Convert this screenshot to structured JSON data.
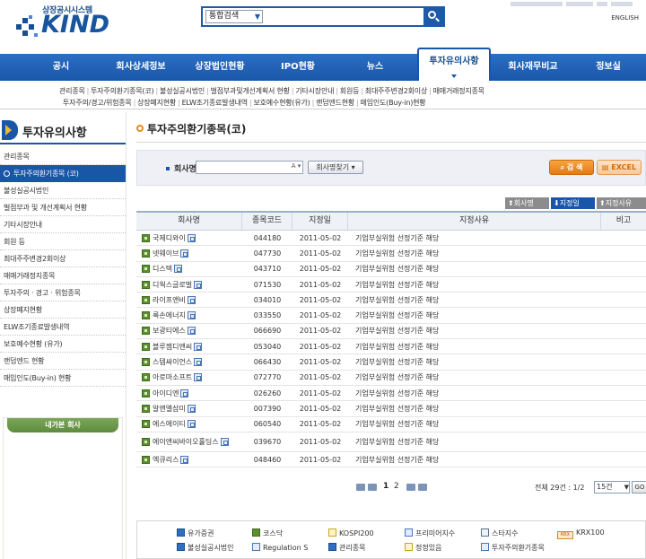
{
  "header": {
    "logo_sub": "상장공시시스템",
    "logo": "KIND",
    "search_scope": "통합검색",
    "search_value": "",
    "english": "ENGLISH"
  },
  "nav": {
    "items": [
      "공시",
      "회사상세정보",
      "상장법인현황",
      "IPO현황",
      "뉴스",
      "투자유의사항",
      "회사재무비교",
      "정보실"
    ]
  },
  "subnav": {
    "row1": [
      "관리종목",
      "투자주의환기종목(코)",
      "불성실공시법인",
      "벌점부과및개선계획서 현황",
      "기타시장안내",
      "회원등",
      "최대주주변경2회이상",
      "매매거래정지종목"
    ],
    "row2": [
      "투자주의/경고/위험종목",
      "상장폐지현황",
      "ELW조기종료발생내역",
      "보호예수현황(유가)",
      "랜덤엔드현황",
      "매입인도(Buy-in)현황"
    ]
  },
  "sidebar": {
    "title": "투자유의사항",
    "items": [
      "관리종목",
      "투자주의환기종목 (코)",
      "불성실공시법인",
      "벌점부과 및 개선계획서 현황",
      "기타시장안내",
      "회원 등",
      "최대주주변경2회이상",
      "매매거래정지종목",
      "투자주의 · 경고 · 위험종목",
      "상장폐지현황",
      "ELW조기종료발생내역",
      "보호예수현황 (유가)",
      "랜덤엔드 현황",
      "매입인도(Buy-in) 현황"
    ],
    "box_title": "내가본 회사"
  },
  "main": {
    "title": "투자주의환기종목(코)",
    "search_label": "회사명",
    "search_value": "",
    "search_a": "A",
    "find_company": "회사명찾기",
    "btn_search": "검 색",
    "btn_excel": "EXCEL",
    "sort": [
      "회사명",
      "지정일",
      "지정사유"
    ],
    "columns": [
      "회사명",
      "종목코드",
      "지정일",
      "지정사유",
      "비고"
    ],
    "rows": [
      {
        "name": "국제디와이",
        "code": "044180",
        "date": "2011-05-02",
        "reason": "기업부실위험 선정기준 해당"
      },
      {
        "name": "넷웨이브",
        "code": "047730",
        "date": "2011-05-02",
        "reason": "기업부실위험 선정기준 해당"
      },
      {
        "name": "디스텍",
        "code": "043710",
        "date": "2011-05-02",
        "reason": "기업부실위험 선정기준 해당"
      },
      {
        "name": "디웍스글로벌",
        "code": "071530",
        "date": "2011-05-02",
        "reason": "기업부실위험 선정기준 해당"
      },
      {
        "name": "라이프앤비",
        "code": "034010",
        "date": "2011-05-02",
        "reason": "기업부실위험 선정기준 해당"
      },
      {
        "name": "룩손에너지",
        "code": "033550",
        "date": "2011-05-02",
        "reason": "기업부실위험 선정기준 해당"
      },
      {
        "name": "보광티에스",
        "code": "066690",
        "date": "2011-05-02",
        "reason": "기업부실위험 선정기준 해당"
      },
      {
        "name": "블루젬디앤씨",
        "code": "053040",
        "date": "2011-05-02",
        "reason": "기업부실위험 선정기준 해당"
      },
      {
        "name": "스템싸이언스",
        "code": "066430",
        "date": "2011-05-02",
        "reason": "기업부실위험 선정기준 해당"
      },
      {
        "name": "아로마소프트",
        "code": "072770",
        "date": "2011-05-02",
        "reason": "기업부실위험 선정기준 해당"
      },
      {
        "name": "아이디엔",
        "code": "026260",
        "date": "2011-05-02",
        "reason": "기업부실위험 선정기준 해당"
      },
      {
        "name": "알앤엘삼미",
        "code": "007390",
        "date": "2011-05-02",
        "reason": "기업부실위험 선정기준 해당"
      },
      {
        "name": "에스에이티",
        "code": "060540",
        "date": "2011-05-02",
        "reason": "기업부실위험 선정기준 해당"
      },
      {
        "name": "에이앤씨바이오홀딩스",
        "code": "039670",
        "date": "2011-05-02",
        "reason": "기업부실위험 선정기준 해당"
      },
      {
        "name": "엑큐리스",
        "code": "048460",
        "date": "2011-05-02",
        "reason": "기업부실위험 선정기준 해당"
      }
    ],
    "pages": [
      "1",
      "2"
    ],
    "total": "전체 29건 : 1/2",
    "per_page": "15건",
    "go": "GO"
  },
  "legend": {
    "items": [
      "유가증권",
      "코스닥",
      "KOSPI200",
      "프리미어지수",
      "스타지수",
      "KRX100",
      "불성실공시법인",
      "Regulation S",
      "관리종목",
      "정정있음",
      "투자주의환기종목"
    ],
    "krx_badge": "KRX"
  },
  "colors": {
    "brand": "#1a56a8",
    "accent": "#e67a13",
    "kosdaq": "#5e8f2e"
  }
}
